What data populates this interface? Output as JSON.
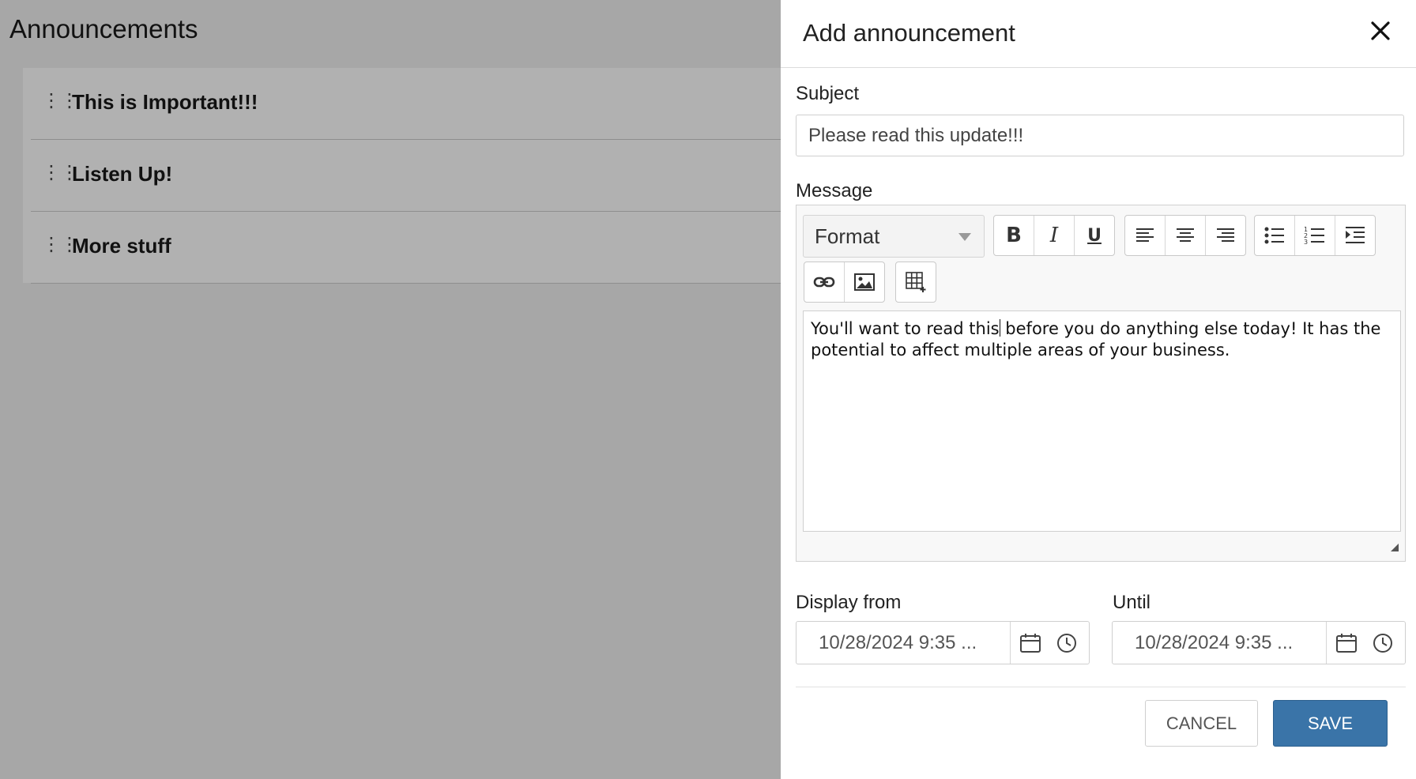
{
  "background": {
    "title": "Announcements",
    "items": [
      {
        "title": "This is Important!!!"
      },
      {
        "title": "Listen Up!"
      },
      {
        "title": "More stuff"
      }
    ]
  },
  "panel": {
    "title": "Add announcement",
    "subject_label": "Subject",
    "subject_value": "Please read this update!!!",
    "message_label": "Message",
    "format_value": "Format",
    "message_text_before_caret": "You'll want to read this",
    "message_text_after_caret": " before you do anything else today! It has the potential to affect multiple areas of your business.",
    "display_from_label": "Display from",
    "display_from_value": "10/28/2024 9:35 ...",
    "until_label": "Until",
    "until_value": "10/28/2024 9:35 ...",
    "cancel_label": "CANCEL",
    "save_label": "SAVE"
  },
  "colors": {
    "overlay": "#a7a7a7",
    "primary": "#3a74a8"
  }
}
